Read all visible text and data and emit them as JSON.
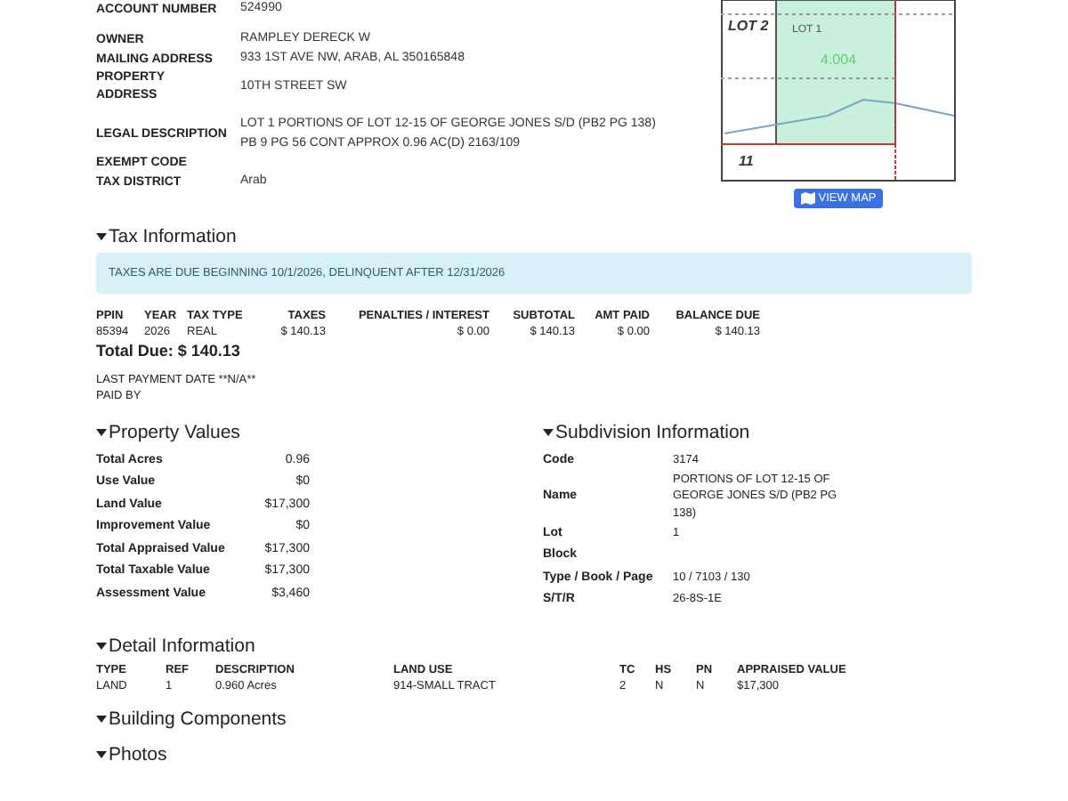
{
  "account": {
    "label": "ACCOUNT NUMBER",
    "value": "524990"
  },
  "info": [
    {
      "label": "OWNER",
      "value": "RAMPLEY DERECK W"
    },
    {
      "label": "MAILING ADDRESS",
      "value": "933 1ST AVE NW,  ARAB, AL 350165848"
    },
    {
      "label": "PROPERTY ADDRESS",
      "value": "10TH STREET SW"
    },
    {
      "label": "LEGAL DESCRIPTION",
      "value": "LOT 1 PORTIONS OF LOT 12-15 OF GEORGE JONES S/D (PB2 PG 138) PB 9 PG 56 CONT APPROX 0.96 AC(D) 2163/109"
    },
    {
      "label": "EXEMPT CODE"
    },
    {
      "label": "TAX DISTRICT",
      "value": "Arab"
    }
  ],
  "map": {
    "labels": [
      "LOT 2",
      "LOT 1",
      "4.004",
      "11"
    ],
    "button": "VIEW MAP"
  },
  "tax": {
    "title": "Tax Information",
    "notice": "TAXES ARE DUE BEGINNING 10/1/2026, DELINQUENT AFTER 12/31/2026",
    "columns": [
      "PPIN",
      "YEAR",
      "TAX TYPE",
      "TAXES",
      "PENALTIES / INTEREST",
      "SUBTOTAL",
      "AMT PAID",
      "BALANCE DUE"
    ],
    "rows": [
      [
        "85394",
        "2026",
        "REAL",
        "$ 140.13",
        "$ 0.00",
        "$ 140.13",
        "$ 0.00",
        "$ 140.13"
      ]
    ],
    "total": "Total Due: $ 140.13",
    "last_payment": "LAST PAYMENT DATE **N/A**",
    "paid_by": "PAID BY"
  },
  "property_values": {
    "title": "Property Values",
    "rows": [
      {
        "label": "Total Acres",
        "value": "0.96"
      },
      {
        "label": "Use Value",
        "value": "$0"
      },
      {
        "label": "Land Value",
        "value": "$17,300"
      },
      {
        "label": "Improvement Value",
        "value": "$0"
      },
      {
        "label": "Total Appraised Value",
        "value": "$17,300"
      },
      {
        "label": "Total Taxable Value",
        "value": "$17,300"
      },
      {
        "label": "Assessment Value",
        "value": "$3,460"
      }
    ]
  },
  "subdivision": {
    "title": "Subdivision Information",
    "rows": [
      {
        "label": "Code",
        "value": "3174"
      },
      {
        "label": "Name",
        "value": "PORTIONS OF LOT 12-15 OF GEORGE JONES S/D (PB2 PG 138)"
      },
      {
        "label": "Lot",
        "value": "1"
      },
      {
        "label": "Block"
      },
      {
        "label": "Type / Book / Page",
        "value": "10 / 7103 / 130"
      },
      {
        "label": "S/T/R",
        "value": "26-8S-1E"
      }
    ]
  },
  "detail": {
    "title": "Detail Information",
    "columns": [
      "TYPE",
      "REF",
      "DESCRIPTION",
      "LAND USE",
      "TC",
      "HS",
      "PN",
      "APPRAISED VALUE"
    ],
    "rows": [
      [
        "LAND",
        "1",
        "0.960 Acres",
        "914-SMALL TRACT",
        "2",
        "N",
        "N",
        "$17,300"
      ]
    ]
  },
  "sections": [
    "Building Components",
    "Photos"
  ]
}
